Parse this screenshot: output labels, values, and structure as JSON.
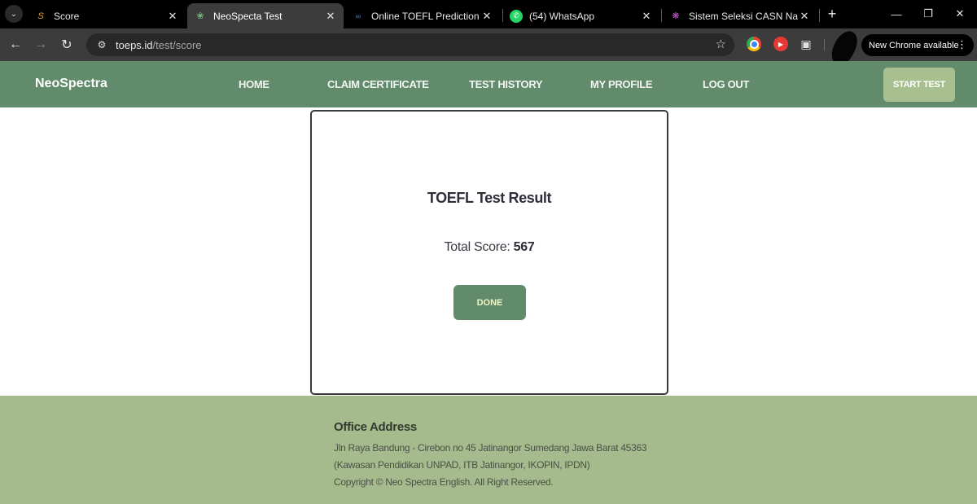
{
  "browser": {
    "tabs": [
      {
        "title": "Score",
        "favicon": "score-favicon",
        "active": false
      },
      {
        "title": "NeoSpecta Test",
        "favicon": "leaf-favicon",
        "active": true
      },
      {
        "title": "Online TOEFL Prediction Tes",
        "favicon": "toefl-favicon",
        "active": false
      },
      {
        "title": "(54) WhatsApp",
        "favicon": "whatsapp-favicon",
        "active": false
      },
      {
        "title": "Sistem Seleksi CASN Nasiona",
        "favicon": "casn-favicon",
        "active": false
      }
    ],
    "url_host": "toeps.id",
    "url_path": "/test/score",
    "update_label": "New Chrome available"
  },
  "site": {
    "brand": "NeoSpectra",
    "menu": [
      {
        "label": "HOME"
      },
      {
        "label": "CLAIM CERTIFICATE"
      },
      {
        "label": "TEST HISTORY"
      },
      {
        "label": "MY PROFILE"
      },
      {
        "label": "LOG OUT"
      }
    ],
    "start_test": "START TEST"
  },
  "result": {
    "title": "TOEFL Test Result",
    "score_label": "Total Score:",
    "score_value": "567",
    "done_label": "DONE"
  },
  "footer": {
    "heading": "Office Address",
    "line1": "Jln Raya Bandung - Cirebon no 45 Jatinangor Sumedang Jawa Barat 45363",
    "line2": "(Kawasan Pendidikan UNPAD, ITB Jatinangor, IKOPIN, IPDN)",
    "copyright": "Copyright © Neo Spectra English. All Right Reserved."
  },
  "colors": {
    "nav_green": "#628b6c",
    "start_button": "#a8c08f",
    "footer_green": "#a5bb8e"
  }
}
